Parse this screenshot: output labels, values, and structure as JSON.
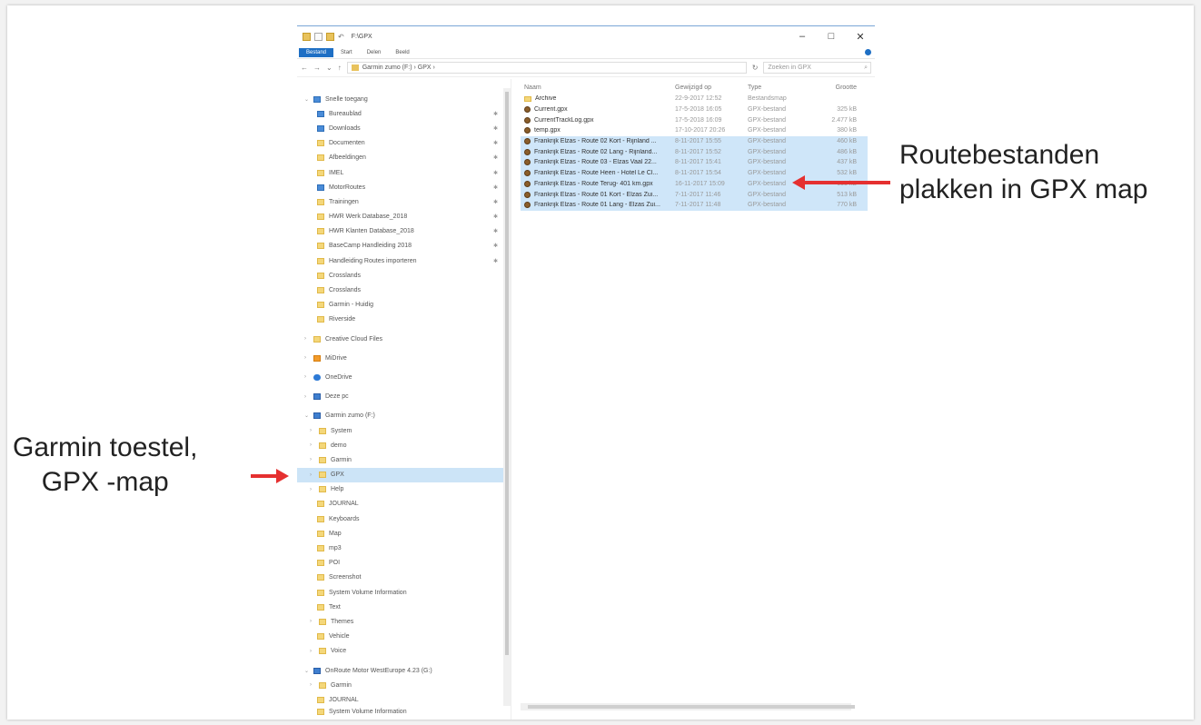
{
  "callouts": {
    "right_line1": "Routebestanden",
    "right_line2": "plakken in GPX map",
    "left_line1": "Garmin toestel,",
    "left_line2": "GPX -map"
  },
  "colors": {
    "arrow": "#e53030",
    "selection": "#cce4f7",
    "accent": "#1e6fc4"
  },
  "window": {
    "title": "F:\\GPX",
    "ribbon_tabs": [
      "Bestand",
      "Start",
      "Delen",
      "Beeld"
    ],
    "path": "Garmin zumo (F:) › GPX ›",
    "search_placeholder": "Zoeken in GPX"
  },
  "nav": {
    "quick_access": "Snelle toegang",
    "items": [
      "Bureaublad",
      "Downloads",
      "Documenten",
      "Afbeeldingen",
      "IMEL",
      "MotorRoutes",
      "Trainingen",
      "HWR Werk Database_2018",
      "HWR Klanten Database_2018",
      "BaseCamp Handleiding 2018",
      "Handleiding Routes importeren",
      "Crosslands",
      "Crosslands",
      "Garmin - Huidig",
      "Riverside"
    ],
    "roots": [
      "Creative Cloud Files",
      "MiDrive",
      "OneDrive",
      "Deze pc"
    ],
    "drive": "Garmin zumo (F:)",
    "drive_items": [
      "System",
      "demo",
      "Garmin",
      "GPX",
      "Help",
      "JOURNAL",
      "Keyboards",
      "Map",
      "mp3",
      "POI",
      "Screenshot",
      "System Volume Information",
      "Text",
      "Themes",
      "Vehicle",
      "Voice"
    ],
    "second_drive": "OnRoute Motor WestEurope 4.23 (G:)",
    "second_drive_items": [
      "Garmin",
      "JOURNAL",
      "System Volume Information"
    ]
  },
  "files": {
    "headers": [
      "Naam",
      "Gewijzigd op",
      "Type",
      "Grootte"
    ],
    "rows": [
      {
        "name": "Archive",
        "date": "22-9-2017 12:52",
        "type": "Bestandsmap",
        "size": ""
      },
      {
        "name": "Current.gpx",
        "date": "17-5-2018 16:05",
        "type": "GPX-bestand",
        "size": "325 kB"
      },
      {
        "name": "CurrentTrackLog.gpx",
        "date": "17-5-2018 16:09",
        "type": "GPX-bestand",
        "size": "2.477 kB"
      },
      {
        "name": "temp.gpx",
        "date": "17-10-2017 20:26",
        "type": "GPX-bestand",
        "size": "380 kB"
      },
      {
        "name": "Frankrijk Elzas - Route 02 Kort - Rijnland ...",
        "date": "8-11-2017 15:55",
        "type": "GPX-bestand",
        "size": "460 kB"
      },
      {
        "name": "Frankrijk Elzas - Route 02 Lang - Rijnland...",
        "date": "8-11-2017 15:52",
        "type": "GPX-bestand",
        "size": "486 kB"
      },
      {
        "name": "Frankrijk Elzas - Route 03 - Elzas Vaal 22...",
        "date": "8-11-2017 15:41",
        "type": "GPX-bestand",
        "size": "437 kB"
      },
      {
        "name": "Frankrijk Elzas - Route Heen - Hotel Le Cl...",
        "date": "8-11-2017 15:54",
        "type": "GPX-bestand",
        "size": "532 kB"
      },
      {
        "name": "Frankrijk Elzas - Route Terug- 401 km.gpx",
        "date": "16-11-2017 15:09",
        "type": "GPX-bestand",
        "size": "653 kB"
      },
      {
        "name": "Frankrijk Elzas - Route 01 Kort - Elzas Zui...",
        "date": "7-11-2017 11:46",
        "type": "GPX-bestand",
        "size": "513 kB"
      },
      {
        "name": "Frankrijk Elzas - Route 01 Lang - Elzas Zui...",
        "date": "7-11-2017 11:48",
        "type": "GPX-bestand",
        "size": "770 kB"
      }
    ]
  }
}
